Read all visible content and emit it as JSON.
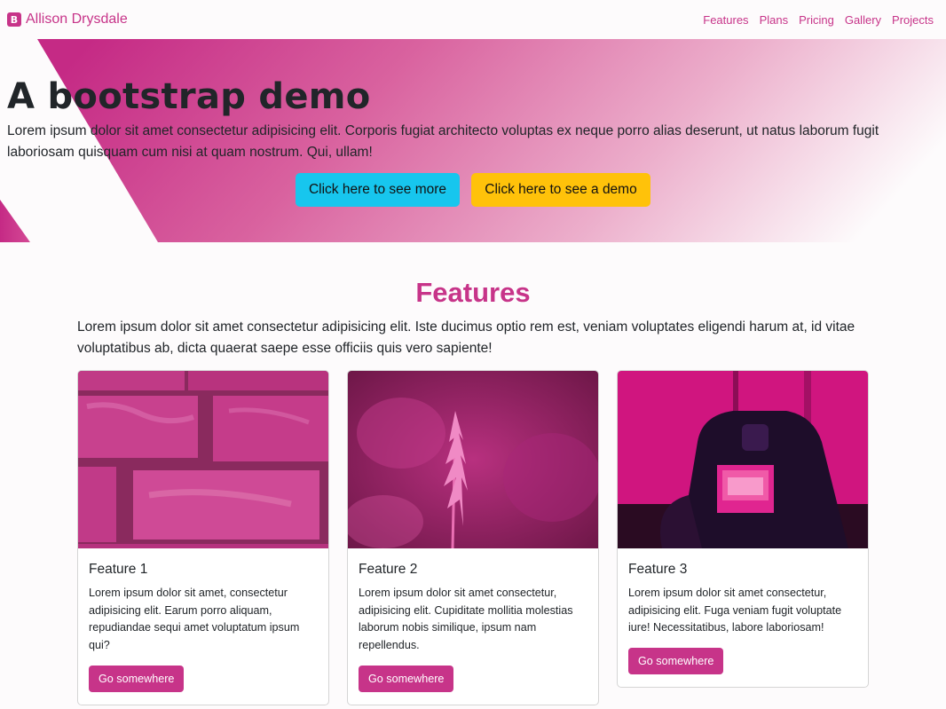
{
  "brand": {
    "icon_letter": "B",
    "name": "Allison Drysdale"
  },
  "nav": {
    "items": [
      "Features",
      "Plans",
      "Pricing",
      "Gallery",
      "Projects"
    ]
  },
  "hero": {
    "title": "A bootstrap demo",
    "text": "Lorem ipsum dolor sit amet consectetur adipisicing elit. Corporis fugiat architecto voluptas ex neque porro alias deserunt, ut natus laborum fugit laboriosam quisquam cum nisi at quam nostrum. Qui, ullam!",
    "primary_button": "Click here to see more",
    "secondary_button": "Click here to see a demo"
  },
  "features": {
    "title": "Features",
    "description": "Lorem ipsum dolor sit amet consectetur adipisicing elit. Iste ducimus optio rem est, veniam voluptates eligendi harum at, id vitae voluptatibus ab, dicta quaerat saepe esse officiis quis vero sapiente!",
    "cards": [
      {
        "title": "Feature 1",
        "text": "Lorem ipsum dolor sit amet, consectetur adipisicing elit. Earum porro aliquam, repudiandae sequi amet voluptatum ipsum qui?",
        "button": "Go somewhere",
        "image": "pink-brick-wall"
      },
      {
        "title": "Feature 2",
        "text": "Lorem ipsum dolor sit amet consectetur, adipisicing elit. Cupiditate mollitia molestias laborum nobis similique, ipsum nam repellendus.",
        "button": "Go somewhere",
        "image": "pink-flower"
      },
      {
        "title": "Feature 3",
        "text": "Lorem ipsum dolor sit amet consectetur, adipisicing elit. Fuga veniam fugit voluptate iure! Necessitatibus, labore laboriosam!",
        "button": "Go somewhere",
        "image": "camera-screen"
      }
    ]
  },
  "colors": {
    "primary": "#c73489",
    "info": "#17c6ee",
    "warning": "#ffc20a"
  }
}
